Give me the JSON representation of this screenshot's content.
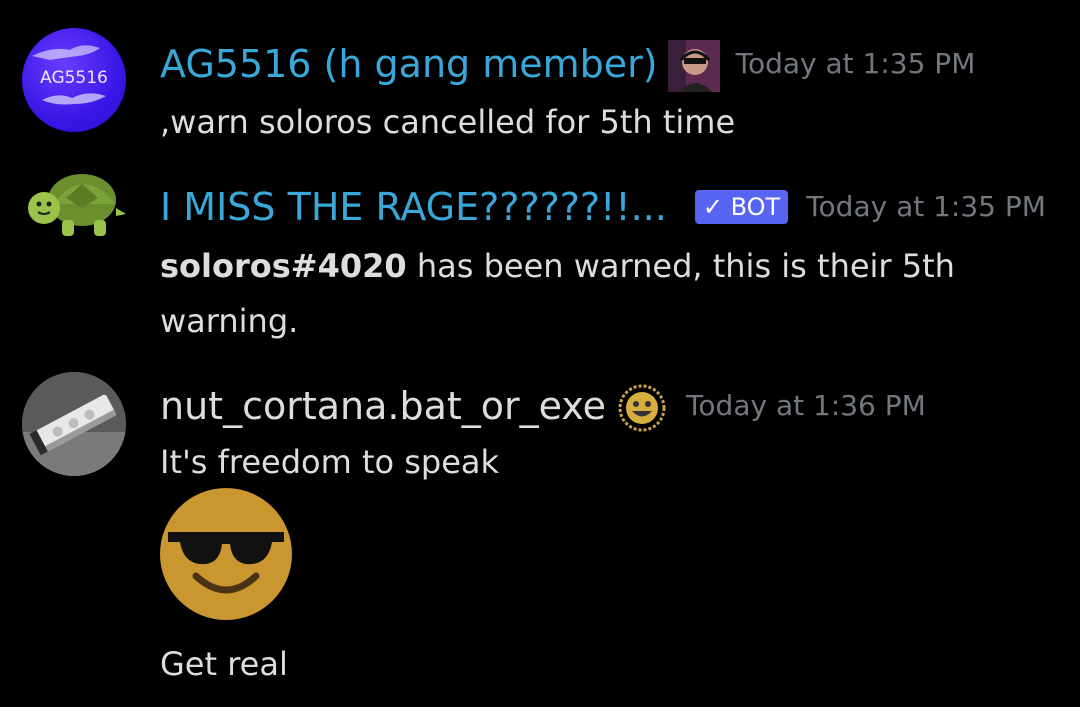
{
  "colors": {
    "background": "#000000",
    "username_blue": "#3aa7d9",
    "username_default": "#dcddde",
    "timestamp": "#72767d",
    "bot_badge": "#5865f2"
  },
  "messages": [
    {
      "username": "AG5516 (h gang member)",
      "avatar_text": "AG5516",
      "role_icon": "person-with-headset-icon",
      "timestamp": "Today at 1:35 PM",
      "text": ",warn soloros cancelled for 5th time"
    },
    {
      "username": "I MISS THE RAGE??????!!...",
      "avatar_icon": "turtle-icon",
      "bot_badge": "✓ BOT",
      "timestamp": "Today at 1:35 PM",
      "mention": "soloros#4020",
      "text_line1": " has been warned, this is their 5th",
      "text_line2": "warning."
    },
    {
      "username": "nut_cortana.bat_or_exe",
      "avatar_icon": "power-strip-icon",
      "role_icon": "smiley-badge-icon",
      "timestamp": "Today at 1:36 PM",
      "text": "It's freedom to speak",
      "emoji": "sunglasses-emoji",
      "text2": "Get real"
    }
  ]
}
